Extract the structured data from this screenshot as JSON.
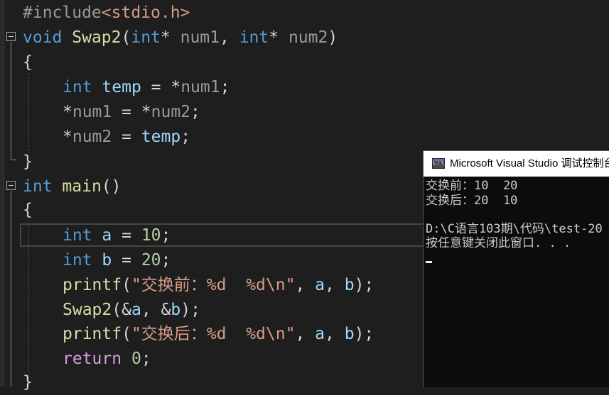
{
  "editor": {
    "lines": [
      {
        "parts": [
          "#include",
          "<stdio.h>"
        ]
      },
      {
        "parts": [
          "void",
          " ",
          "Swap2",
          "(",
          "int",
          "* ",
          "num1",
          ", ",
          "int",
          "* ",
          "num2",
          ")"
        ]
      },
      {
        "parts": [
          "{"
        ]
      },
      {
        "parts": [
          "int",
          " ",
          "temp",
          " = *",
          "num1",
          ";"
        ]
      },
      {
        "parts": [
          "*",
          "num1",
          " = *",
          "num2",
          ";"
        ]
      },
      {
        "parts": [
          "*",
          "num2",
          " = ",
          "temp",
          ";"
        ]
      },
      {
        "parts": [
          "}"
        ]
      },
      {
        "parts": [
          "int",
          " ",
          "main",
          "()"
        ]
      },
      {
        "parts": [
          "{"
        ]
      },
      {
        "parts": [
          "int",
          " ",
          "a",
          " = ",
          "10",
          ";"
        ]
      },
      {
        "parts": [
          "int",
          " ",
          "b",
          " = ",
          "20",
          ";"
        ]
      },
      {
        "parts": [
          "printf",
          "(",
          "\"交换前：%d  %d\\n\"",
          ", ",
          "a",
          ", ",
          "b",
          ");"
        ]
      },
      {
        "parts": [
          "Swap2",
          "(&",
          "a",
          ", &",
          "b",
          ");"
        ]
      },
      {
        "parts": [
          "printf",
          "(",
          "\"交换后：%d  %d\\n\"",
          ", ",
          "a",
          ", ",
          "b",
          ");"
        ]
      },
      {
        "parts": [
          "return",
          " ",
          "0",
          ";"
        ]
      },
      {
        "parts": [
          "}"
        ]
      }
    ]
  },
  "console": {
    "icon_label": "C:\\",
    "title": "Microsoft Visual Studio 调试控制台",
    "lines": [
      "交换前：10  20",
      "交换后：20  10",
      "",
      "D:\\C语言103期\\代码\\test-20",
      "按任意键关闭此窗口. . ."
    ]
  },
  "icons": {
    "fold": "collapse-box-icon",
    "console": "console-app-icon"
  },
  "colors": {
    "background": "#1e1e1e",
    "keyword": "#569cd6",
    "function": "#dcdcaa",
    "string": "#d69d85",
    "number": "#b5cea8",
    "variable": "#9cdcfe",
    "control": "#d8a0df",
    "console_bg": "#0c0c0c"
  }
}
